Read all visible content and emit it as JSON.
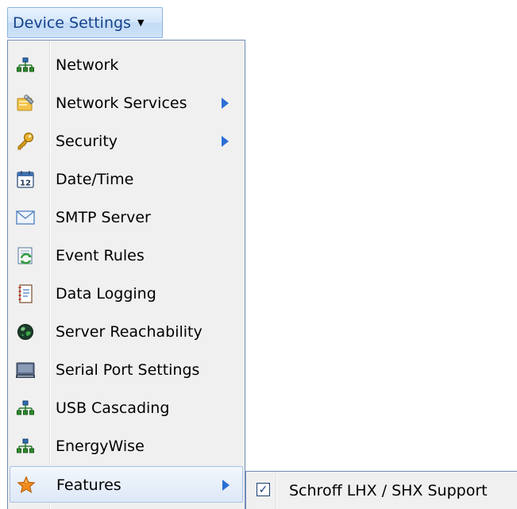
{
  "menu_button": {
    "label": "Device Settings",
    "caret": "▼"
  },
  "menu": {
    "items": [
      {
        "label": "Network",
        "icon": "network-icon",
        "has_submenu": false
      },
      {
        "label": "Network Services",
        "icon": "network-services-icon",
        "has_submenu": true
      },
      {
        "label": "Security",
        "icon": "key-icon",
        "has_submenu": true
      },
      {
        "label": "Date/Time",
        "icon": "calendar-icon",
        "has_submenu": false
      },
      {
        "label": "SMTP Server",
        "icon": "envelope-icon",
        "has_submenu": false
      },
      {
        "label": "Event Rules",
        "icon": "event-rules-icon",
        "has_submenu": false
      },
      {
        "label": "Data Logging",
        "icon": "notebook-icon",
        "has_submenu": false
      },
      {
        "label": "Server Reachability",
        "icon": "globe-icon",
        "has_submenu": false
      },
      {
        "label": "Serial Port Settings",
        "icon": "serial-port-icon",
        "has_submenu": false
      },
      {
        "label": "USB Cascading",
        "icon": "network-icon",
        "has_submenu": false
      },
      {
        "label": "EnergyWise",
        "icon": "network-icon",
        "has_submenu": false
      },
      {
        "label": "Features",
        "icon": "star-icon",
        "has_submenu": true,
        "active": true
      }
    ]
  },
  "submenu": {
    "items": [
      {
        "label": "Schroff LHX / SHX Support",
        "checked": true,
        "check_glyph": "✓"
      }
    ]
  },
  "colors": {
    "menu_bg": "#f0f0f0",
    "menu_border": "#718bb7",
    "button_text": "#15428b",
    "arrow": "#2a6fd6"
  }
}
